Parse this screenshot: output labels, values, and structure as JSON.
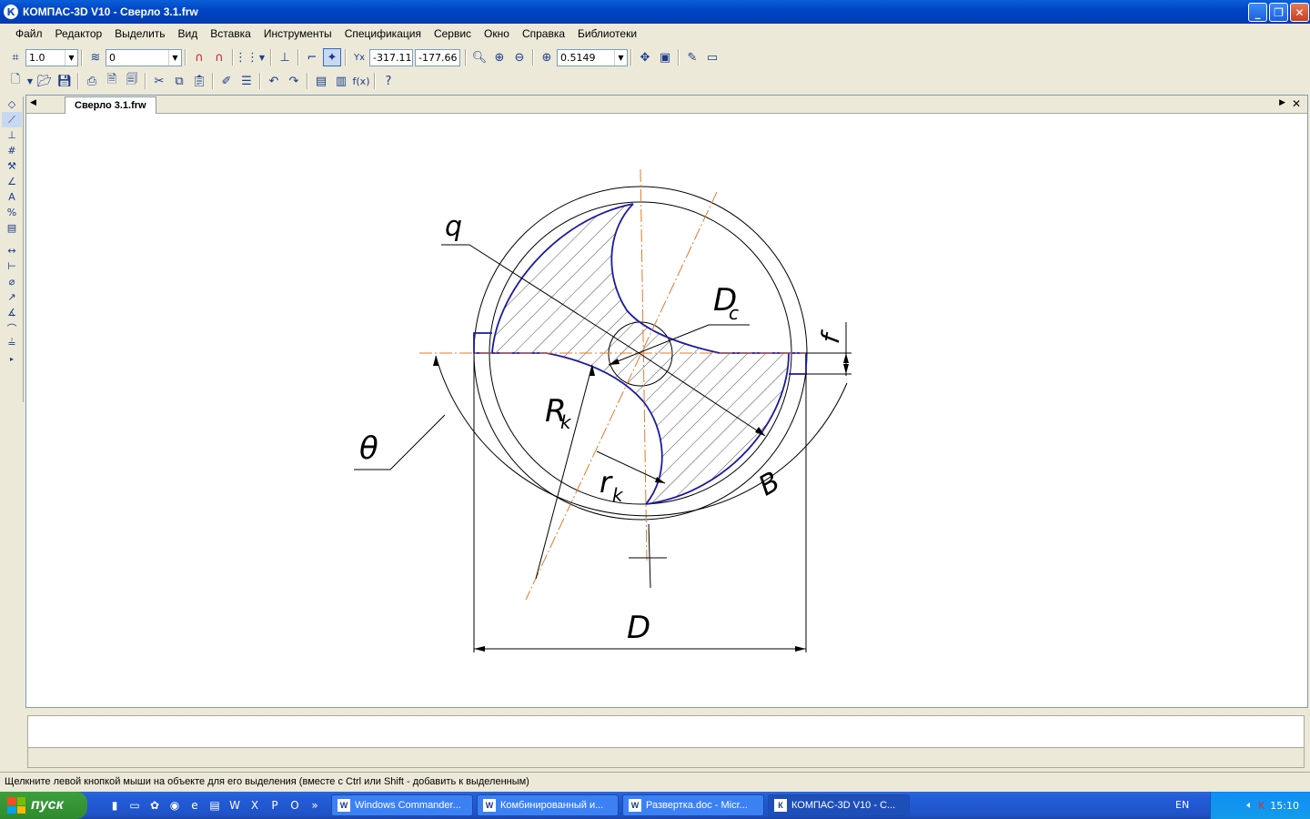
{
  "window": {
    "title": "КОМПАС-3D V10 - Сверло 3.1.frw",
    "icon": "К"
  },
  "window_buttons": {
    "minimize": "_",
    "maximize": "❐",
    "close": "✕"
  },
  "menu": [
    "Файл",
    "Редактор",
    "Выделить",
    "Вид",
    "Вставка",
    "Инструменты",
    "Спецификация",
    "Сервис",
    "Окно",
    "Справка",
    "Библиотеки"
  ],
  "toolbar1": {
    "step_value": "1.0",
    "layer_value": "0",
    "coord_x": "-317.11",
    "coord_y": "-177.66",
    "zoom_value": "0.5149"
  },
  "document": {
    "tab_label": "Сверло 3.1.frw"
  },
  "drawing": {
    "labels": {
      "q": "q",
      "dc": "D",
      "dc_sub": "c",
      "f": "f",
      "rk": "R",
      "rk_sub": "k",
      "theta": "θ",
      "rk2": "r",
      "rk2_sub": "k",
      "b": "B",
      "d": "D"
    }
  },
  "status": {
    "text": "Щелкните левой кнопкой мыши на объекте для его выделения (вместе с Ctrl или Shift - добавить к выделенным)"
  },
  "taskbar": {
    "start_label": "пуск",
    "tasks": [
      {
        "label": "Windows Commander...",
        "icon": "W"
      },
      {
        "label": "Комбинированный и...",
        "icon": "W"
      },
      {
        "label": "Развертка.doc - Micr...",
        "icon": "W"
      },
      {
        "label": "КОМПАС-3D V10 - С...",
        "icon": "К"
      }
    ],
    "language": "EN",
    "clock": "15:10"
  },
  "colors": {
    "contour": "#1a1aa8",
    "axis": "#e07b2a",
    "hatch": "#000000"
  }
}
